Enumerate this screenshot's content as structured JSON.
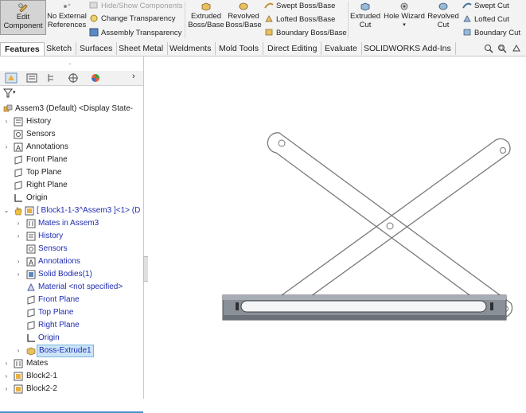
{
  "ribbon": {
    "edit_component": "Edit\nComponent",
    "no_external_references": "No External\nReferences",
    "hide_show_components": "Hide/Show Components",
    "change_transparency": "Change Transparency",
    "assembly_transparency": "Assembly Transparency",
    "extruded_boss": "Extruded\nBoss/Base",
    "revolved_boss": "Revolved\nBoss/Base",
    "swept_boss": "Swept Boss/Base",
    "lofted_boss": "Lofted Boss/Base",
    "boundary_boss": "Boundary Boss/Base",
    "extruded_cut": "Extruded\nCut",
    "hole_wizard": "Hole Wizard",
    "revolved_cut": "Revolved\nCut",
    "swept_cut": "Swept Cut",
    "lofted_cut": "Lofted Cut",
    "boundary_cut": "Boundary Cut"
  },
  "tabs": [
    "Features",
    "Sketch",
    "Surfaces",
    "Sheet Metal",
    "Weldments",
    "Mold Tools",
    "Direct Editing",
    "Evaluate",
    "SOLIDWORKS Add-Ins"
  ],
  "tree": {
    "root": "Assem3  (Default) <Display State-",
    "history": "History",
    "sensors": "Sensors",
    "annotations": "Annotations",
    "front_plane": "Front Plane",
    "top_plane": "Top Plane",
    "right_plane": "Right Plane",
    "origin": "Origin",
    "block1": "[ Block1-1-3^Assem3 ]<1> (D",
    "mates_in_assem": "Mates in Assem3",
    "c_history": "History",
    "c_sensors": "Sensors",
    "c_annotations": "Annotations",
    "solid_bodies": "Solid Bodies(1)",
    "material": "Material <not specified>",
    "c_front_plane": "Front Plane",
    "c_top_plane": "Top Plane",
    "c_right_plane": "Right Plane",
    "c_origin": "Origin",
    "boss_extrude": "Boss-Extrude1",
    "mates": "Mates",
    "block2_1": "Block2-1",
    "block2_2": "Block2-2"
  },
  "colors": {
    "tree_blue": "#1f2cb0",
    "selection": "#cbe4f7",
    "accent": "#4a90c8"
  }
}
